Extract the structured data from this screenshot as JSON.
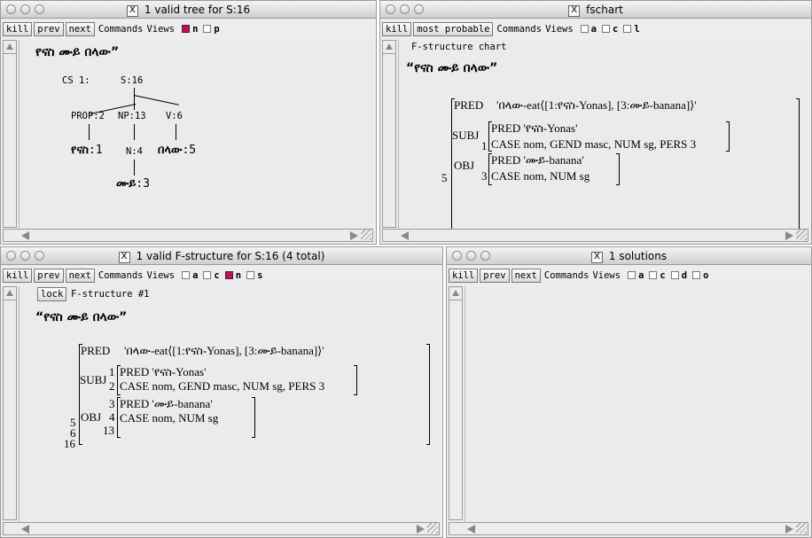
{
  "win1": {
    "title": "1 valid tree for S:16",
    "buttons": [
      "kill",
      "prev",
      "next"
    ],
    "commands": "Commands",
    "views": "Views",
    "checks": [
      {
        "label": "n",
        "on": true
      },
      {
        "label": "p",
        "on": false
      }
    ],
    "sentence": "የናስ ሙይ በላው”",
    "tree": {
      "cs": "CS 1:",
      "root": "S:16",
      "prop": "PROP:2",
      "np": "NP:13",
      "v": "V:6",
      "w1": "የናስ",
      "w1_num": ":1",
      "n": "N:4",
      "w3": "በላው",
      "w3_num": ":5",
      "w2": "ሙይ",
      "w2_num": ":3"
    }
  },
  "win2": {
    "title": "fschart",
    "buttons": [
      "kill",
      "most probable"
    ],
    "commands": "Commands",
    "views": "Views",
    "checks": [
      {
        "label": "a",
        "on": false
      },
      {
        "label": "c",
        "on": false
      },
      {
        "label": "l",
        "on": false
      }
    ],
    "header": "F-structure chart",
    "sentence": "“የናስ ሙይ በላው”",
    "pred_key": "PRED",
    "pred_val": "'በላው-eat⟨[1:የናስ-Yonas], [3:ሙይ-banana]⟩'",
    "subj_key": "SUBJ",
    "subj_idx": "1",
    "subj_pred": "PRED 'የናስ-Yonas'",
    "subj_feats": "CASE nom, GEND masc, NUM sg, PERS 3",
    "obj_key": "OBJ",
    "obj_idx": "3",
    "obj_pred": "PRED 'ሙይ-banana'",
    "obj_feats": "CASE nom, NUM sg",
    "outer_idx": "5"
  },
  "win3": {
    "title": "1 valid F-structure for S:16 (4 total)",
    "buttons": [
      "kill",
      "prev",
      "next"
    ],
    "commands": "Commands",
    "views": "Views",
    "checks": [
      {
        "label": "a",
        "on": false
      },
      {
        "label": "c",
        "on": false
      },
      {
        "label": "n",
        "on": true
      },
      {
        "label": "s",
        "on": false
      }
    ],
    "lock": "lock",
    "fs_label": "F-structure #1",
    "sentence": "“የናስ ሙይ በላው”",
    "pred_key": "PRED",
    "pred_val": "'በላው-eat⟨[1:የናስ-Yonas], [3:ሙይ-banana]⟩'",
    "subj_key": "SUBJ",
    "subj_idx1": "1",
    "subj_idx2": "2",
    "subj_pred": "PRED 'የናስ-Yonas'",
    "subj_feats": "CASE nom, GEND masc, NUM sg, PERS 3",
    "obj_key": "OBJ",
    "obj_idx1": "3",
    "obj_idx2": "4",
    "obj_idx3": "13",
    "obj_pred": "PRED 'ሙይ-banana'",
    "obj_feats": "CASE nom, NUM sg",
    "outer_idx1": "5",
    "outer_idx2": "6",
    "outer_idx3": "16"
  },
  "win4": {
    "title": "1 solutions",
    "buttons": [
      "kill",
      "prev",
      "next"
    ],
    "commands": "Commands",
    "views": "Views",
    "checks": [
      {
        "label": "a",
        "on": false
      },
      {
        "label": "c",
        "on": false
      },
      {
        "label": "d",
        "on": false
      },
      {
        "label": "o",
        "on": false
      }
    ]
  }
}
